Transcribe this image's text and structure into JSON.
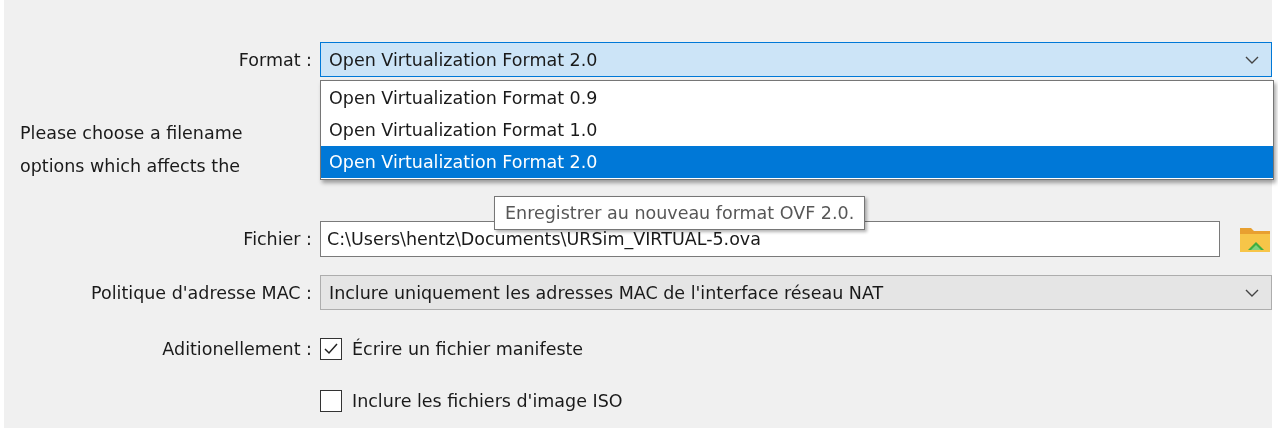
{
  "format": {
    "label": "Format :",
    "value": "Open Virtualization Format 2.0",
    "expanded": true,
    "options": [
      {
        "label": "Open Virtualization Format 0.9",
        "selected": false
      },
      {
        "label": "Open Virtualization Format 1.0",
        "selected": false
      },
      {
        "label": "Open Virtualization Format 2.0",
        "selected": true
      }
    ]
  },
  "description": [
    "Please choose a filename",
    "options which affects the"
  ],
  "file": {
    "label": "Fichier :",
    "value": "C:\\Users\\hentz\\Documents\\URSim_VIRTUAL-5.ova",
    "tooltip": "Enregistrer au nouveau format OVF 2.0."
  },
  "mac_policy": {
    "label": "Politique d'adresse MAC :",
    "value": "Inclure uniquement les adresses MAC de l'interface réseau NAT"
  },
  "additional": {
    "label": "Aditionellement :",
    "options": [
      {
        "label": "Écrire un fichier manifeste",
        "checked": true
      },
      {
        "label": "Inclure les fichiers d'image ISO",
        "checked": false
      }
    ]
  }
}
